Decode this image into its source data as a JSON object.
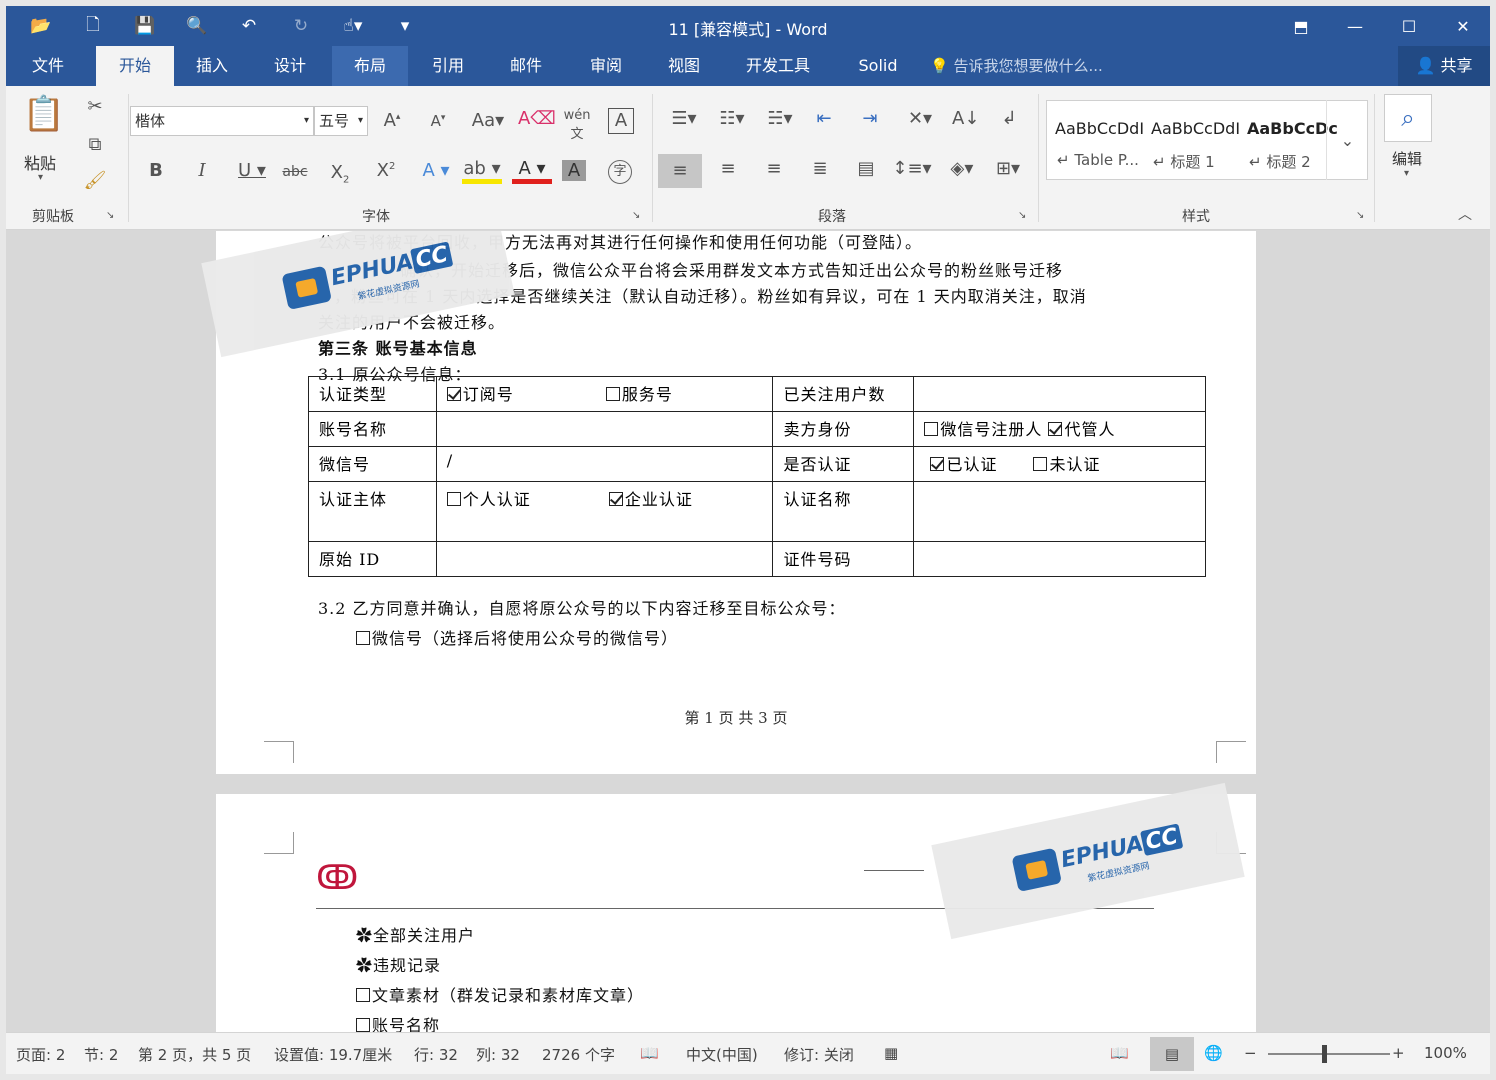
{
  "window": {
    "title": "11 [兼容模式] - Word",
    "controls": [
      "restore-ribbon",
      "minimize",
      "maximize",
      "close"
    ],
    "control_glyphs": [
      "⬒",
      "—",
      "☐",
      "✕"
    ]
  },
  "qat": [
    "open",
    "new",
    "save",
    "print-preview",
    "undo",
    "redo",
    "touch-mode",
    "customize"
  ],
  "tabs": [
    "文件",
    "开始",
    "插入",
    "设计",
    "布局",
    "引用",
    "邮件",
    "审阅",
    "视图",
    "开发工具",
    "Solid"
  ],
  "tellme": "告诉我您想要做什么...",
  "share": "共享",
  "ribbon": {
    "clipboard": {
      "label": "剪贴板",
      "paste": "粘贴"
    },
    "font": {
      "label": "字体",
      "name": "楷体",
      "size": "五号"
    },
    "paragraph": {
      "label": "段落"
    },
    "styles": {
      "label": "样式",
      "items": [
        {
          "preview": "AaBbCcDdI",
          "name": "Table P..."
        },
        {
          "preview": "AaBbCcDdI",
          "name": "标题 1"
        },
        {
          "preview": "AaBbCcDc",
          "name": "标题 2"
        }
      ]
    },
    "edit": {
      "label": "编辑"
    }
  },
  "page1": {
    "line1": "公众号将被平台回收，甲方无法再对其进行任何操作和使用任何功能（可登陆）。",
    "line2": "确认，开始迁移后，微信公众平台将会采用群发文本方式告知迁出公众号的粉丝账号迁移",
    "line3": "，粉丝可在 1 天内选择是否继续关注（默认自动迁移）。粉丝如有异议，可在 1 天内取消关注，取消",
    "line4": "关注的用户不会被迁移。",
    "heading": "第三条  账号基本信息",
    "sub31": "3.1 原公众号信息：",
    "table": {
      "r1": {
        "k1": "认证类型",
        "opt_a": "订阅号",
        "opt_b": "服务号",
        "k2": "已关注用户数",
        "v2": ""
      },
      "r2": {
        "k1": "账号名称",
        "v1": "",
        "k2": "卖方身份",
        "opt_a": "微信号注册人",
        "opt_b": "代管人"
      },
      "r3": {
        "k1": "微信号",
        "v1": "/",
        "k2": "是否认证",
        "opt_a": "已认证",
        "opt_b": "未认证"
      },
      "r4": {
        "k1": "认证主体",
        "opt_a": "个人认证",
        "opt_b": "企业认证",
        "k2": "认证名称",
        "v2": ""
      },
      "r5": {
        "k1": "原始 ID",
        "v1": "",
        "k2": "证件号码",
        "v2": ""
      }
    },
    "sub32": "3.2 乙方同意并确认，自愿将原公众号的以下内容迁移至目标公众号：",
    "wechat_opt": "微信号（选择后将使用公众号的微信号）",
    "footer": "第 1 页 共 3 页"
  },
  "page2": {
    "items": [
      {
        "label": "全部关注用户",
        "type": "circle"
      },
      {
        "label": "违规记录",
        "type": "circle"
      },
      {
        "label": "文章素材（群发记录和素材库文章）",
        "type": "box"
      },
      {
        "label": "账号名称",
        "type": "box"
      }
    ]
  },
  "watermark": {
    "brand": "EPHUA",
    "tld": "CC",
    "sub": "紫花虚拟资源网"
  },
  "status": {
    "page": "页面: 2",
    "section": "节: 2",
    "pages": "第 2 页，共 5 页",
    "setting": "设置值: 19.7厘米",
    "row": "行: 32",
    "col": "列: 32",
    "words": "2726 个字",
    "lang": "中文(中国)",
    "track": "修订: 关闭",
    "zoom": "100%"
  },
  "colors": {
    "titlebar": "#2b579a",
    "ribbon": "#f3f3f3",
    "accent_red": "#c0163c"
  }
}
